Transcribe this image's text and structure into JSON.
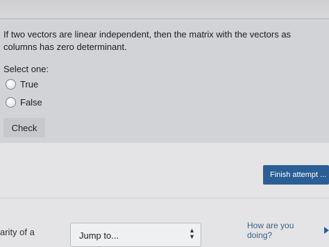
{
  "question": {
    "text": "If two vectors are linear independent, then the matrix with the vectors as columns has zero determinant.",
    "prompt": "Select one:",
    "options": [
      {
        "label": "True",
        "selected": false
      },
      {
        "label": "False",
        "selected": false
      }
    ],
    "check_label": "Check"
  },
  "navigation": {
    "finish_label": "Finish attempt ...",
    "partial_left_text": "arity of a",
    "jump_select_value": "Jump to...",
    "doing_link_label": "How are you doing?"
  },
  "colors": {
    "panel_bg": "#d1d3d6",
    "page_bg": "#e4e4e6",
    "finish_button": "#2b5e94",
    "link": "#3b5f86"
  },
  "icons": {
    "jump_arrows": "up-down-arrows-icon",
    "doing_link": "play-triangle-icon"
  }
}
